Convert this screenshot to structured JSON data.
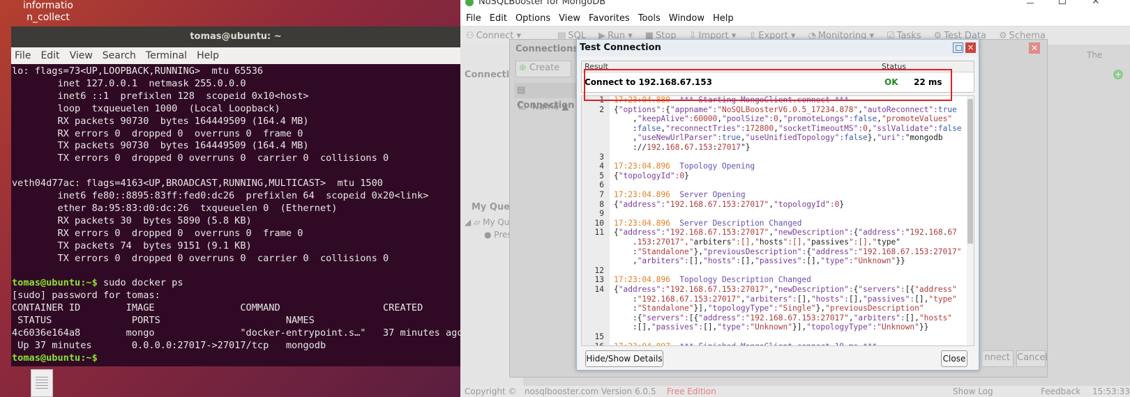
{
  "desktop": {
    "label": "informatio\nn_collect"
  },
  "terminal": {
    "title": "tomas@ubuntu: ~",
    "menu": [
      "File",
      "Edit",
      "View",
      "Search",
      "Terminal",
      "Help"
    ],
    "lines": [
      "lo: flags=73<UP,LOOPBACK,RUNNING>  mtu 65536",
      "        inet 127.0.0.1  netmask 255.0.0.0",
      "        inet6 ::1  prefixlen 128  scopeid 0x10<host>",
      "        loop  txqueuelen 1000  (Local Loopback)",
      "        RX packets 90730  bytes 164449509 (164.4 MB)",
      "        RX errors 0  dropped 0  overruns 0  frame 0",
      "        TX packets 90730  bytes 164449509 (164.4 MB)",
      "        TX errors 0  dropped 0 overruns 0  carrier 0  collisions 0",
      "",
      "veth04d77ac: flags=4163<UP,BROADCAST,RUNNING,MULTICAST>  mtu 1500",
      "        inet6 fe80::8895:83ff:fed0:dc26  prefixlen 64  scopeid 0x20<link>",
      "        ether 8a:95:83:d0:dc:26  txqueuelen 0  (Ethernet)",
      "        RX packets 30  bytes 5890 (5.8 KB)",
      "        RX errors 0  dropped 0  overruns 0  frame 0",
      "        TX packets 74  bytes 9151 (9.1 KB)",
      "        TX errors 0  dropped 0 overruns 0  carrier 0  collisions 0",
      "",
      "",
      "[sudo] password for tomas:",
      "CONTAINER ID        IMAGE               COMMAND                  CREATED",
      " STATUS              PORTS                      NAMES",
      "4c6036e164a8        mongo               \"docker-entrypoint.s…\"   37 minutes ago",
      " Up 37 minutes       0.0.0.0:27017->27017/tcp   mongodb",
      ""
    ],
    "prompt": "tomas@ubuntu",
    "prompt_suffix": ":~$",
    "command": " sudo docker ps"
  },
  "app": {
    "title": "NoSQLBooster for MongoDB",
    "menu": [
      "File",
      "Edit",
      "Options",
      "View",
      "Favorites",
      "Tools",
      "Window",
      "Help"
    ],
    "toolbar": [
      "Connect",
      "SQL",
      "Run",
      "Stop",
      "Import",
      "Export",
      "Monitoring",
      "Tasks",
      "Test Data",
      "Schema"
    ],
    "connection_tree": "Connection Tr",
    "my_queries": "My Queries",
    "my_queries_item": "My Queri",
    "press_item": "Press C",
    "right_label": "The",
    "status": {
      "copyright": "Copyright ©",
      "site": "nosqlbooster.com",
      "version": "Version 6.0.5",
      "edition": "Free Edition",
      "show_log": "Show Log",
      "feedback": "Feedback",
      "time": "15:53:33"
    }
  },
  "connections_dialog": {
    "title": "Connections",
    "create_label": "Create",
    "list_header": "Connection",
    "name_column": "Name",
    "connect_label": "nnect",
    "cancel_label": "Cancel"
  },
  "test_dialog": {
    "title": "Test Connection",
    "result_header": "Result",
    "status_header": "Status",
    "result": "Connect to 192.168.67.153",
    "status": "OK",
    "time": "22 ms",
    "hide_button": "Hide/Show Details",
    "close_button": "Close"
  },
  "log": [
    {
      "n": "1",
      "ts": "17:23:04.880",
      "msg": "*** Starting MongoClient.connect ***"
    },
    {
      "n": "2",
      "text": "{\"options\":{\"appname\":\"NoSQLBoosterV6.0.5_17234.878\",\"autoReconnect\":true"
    },
    {
      "n": "",
      "text": "    ,\"keepAlive\":60000,\"poolSize\":0,\"promoteLongs\":false,\"promoteValues\""
    },
    {
      "n": "",
      "text": "    :false,\"reconnectTries\":172800,\"socketTimeoutMS\":0,\"sslValidate\":false"
    },
    {
      "n": "",
      "text": "    ,\"useNewUrlParser\":true,\"useUnifiedTopology\":false},\"uri\":\"mongodb"
    },
    {
      "n": "",
      "text": "    ://192.168.67.153:27017\"}"
    },
    {
      "n": "3",
      "text": ""
    },
    {
      "n": "4",
      "ts": "17:23:04.896",
      "msg": "Topology Opening"
    },
    {
      "n": "5",
      "text": "{\"topologyId\":0}"
    },
    {
      "n": "6",
      "text": ""
    },
    {
      "n": "7",
      "ts": "17:23:04.896",
      "msg": "Server Opening"
    },
    {
      "n": "8",
      "text": "{\"address\":\"192.168.67.153:27017\",\"topologyId\":0}"
    },
    {
      "n": "9",
      "text": ""
    },
    {
      "n": "10",
      "ts": "17:23:04.896",
      "msg": "Server Description Changed"
    },
    {
      "n": "11",
      "text": "{\"address\":\"192.168.67.153:27017\",\"newDescription\":{\"address\":\"192.168.67"
    },
    {
      "n": "",
      "text": "    .153:27017\",\"arbiters\":[],\"hosts\":[],\"passives\":[],\"type\""
    },
    {
      "n": "",
      "text": "    :\"Standalone\"},\"previousDescription\":{\"address\":\"192.168.67.153:27017\""
    },
    {
      "n": "",
      "text": "    ,\"arbiters\":[],\"hosts\":[],\"passives\":[],\"type\":\"Unknown\"}}"
    },
    {
      "n": "12",
      "text": ""
    },
    {
      "n": "13",
      "ts": "17:23:04.896",
      "msg": "Topology Description Changed"
    },
    {
      "n": "14",
      "text": "{\"address\":\"192.168.67.153:27017\",\"newDescription\":{\"servers\":[{\"address\""
    },
    {
      "n": "",
      "text": "    :\"192.168.67.153:27017\",\"arbiters\":[],\"hosts\":[],\"passives\":[],\"type\""
    },
    {
      "n": "",
      "text": "    :\"Standalone\"}],\"topologyType\":\"Single\"},\"previousDescription\""
    },
    {
      "n": "",
      "text": "    :{\"servers\":[{\"address\":\"192.168.67.153:27017\",\"arbiters\":[],\"hosts\""
    },
    {
      "n": "",
      "text": "    :[],\"passives\":[],\"type\":\"Unknown\"}],\"topologyType\":\"Unknown\"}}"
    },
    {
      "n": "15",
      "text": ""
    },
    {
      "n": "16",
      "ts": "17:23:04.897",
      "msg": "*** Finished MongoClient.connect 18 ms ***"
    }
  ]
}
